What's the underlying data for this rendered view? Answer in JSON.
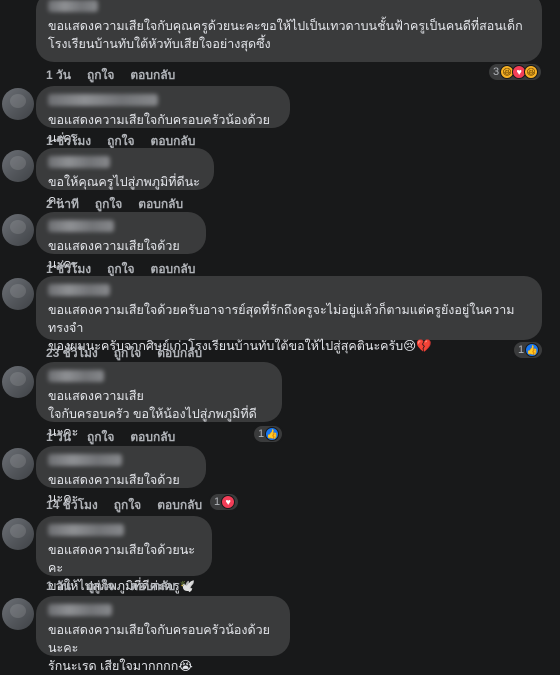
{
  "comments": [
    {
      "text": "ขอแสดงความเสียใจกับคุณครูด้วยนะคะขอให้ไปเป็นเทวดาบนชั้นฟ้าครูเป็นคนดีที่สอนเด็ก\nโรงเรียนบ้านทับใต้หัวทับเสียใจอย่างสุดซึ้ง",
      "time": "1 วัน",
      "like": "ถูกใจ",
      "reply": "ตอบกลับ",
      "reactions_count": "3",
      "reaction_icons": [
        "haha-icon",
        "love-icon",
        "haha-icon"
      ]
    },
    {
      "text": "ขอแสดงความเสียใจกับครอบครัวน้องด้วยนะคะ",
      "time": "1 ชั่วโมง",
      "like": "ถูกใจ",
      "reply": "ตอบกลับ"
    },
    {
      "text": "ขอให้คุณครูไปสู่ภพภูมิที่ดีนะคะ",
      "time": "2 นาที",
      "like": "ถูกใจ",
      "reply": "ตอบกลับ"
    },
    {
      "text": "ขอแสดงความเสียใจด้วยนะคะ",
      "time": "1 ชั่วโมง",
      "like": "ถูกใจ",
      "reply": "ตอบกลับ"
    },
    {
      "text": "ขอแสดงความเสียใจด้วยครับอาจารย์สุดที่รักถึงครูจะไม่อยู่แล้วก็ตามแต่ครูยังอยู่ในความทรงจำ\nของผมนะครับจากศิษย์เก่าโรงเรียนบ้านทับใต้ขอให้ไปสู่สุคตินะครับ😢💔",
      "time": "23 ชั่วโมง",
      "like": "ถูกใจ",
      "reply": "ตอบกลับ",
      "reactions_count": "1"
    },
    {
      "text": "ขอแสดงความเสีย\nใจกับครอบครัว ขอให้น้องไปสู่ภพภูมิที่ดีนะคะ",
      "time": "1 วัน",
      "like": "ถูกใจ",
      "reply": "ตอบกลับ",
      "reactions_count": "1"
    },
    {
      "text": "ขอแสดงความเสียใจด้วยนะคะ",
      "time": "14 ชั่วโมง",
      "like": "ถูกใจ",
      "reply": "ตอบกลับ",
      "reactions_count": "1"
    },
    {
      "text": "ขอแสดงความเสียใจด้วยนะคะ\nขอให้ไปสู่ภพภูมิที่ดีค่ะครู🕊️🙏",
      "time": "1 วัน",
      "like": "ถูกใจ",
      "reply": "ตอบกลับ"
    },
    {
      "text": "ขอแสดงความเสียใจกับครอบครัวน้องด้วยนะคะ\nรักนะเรด เสียใจมากกกก😭"
    }
  ],
  "colors": {
    "like": "#1877f2",
    "love": "#f33e58",
    "bubble": "#3a3b3c",
    "background": "#18191a"
  }
}
